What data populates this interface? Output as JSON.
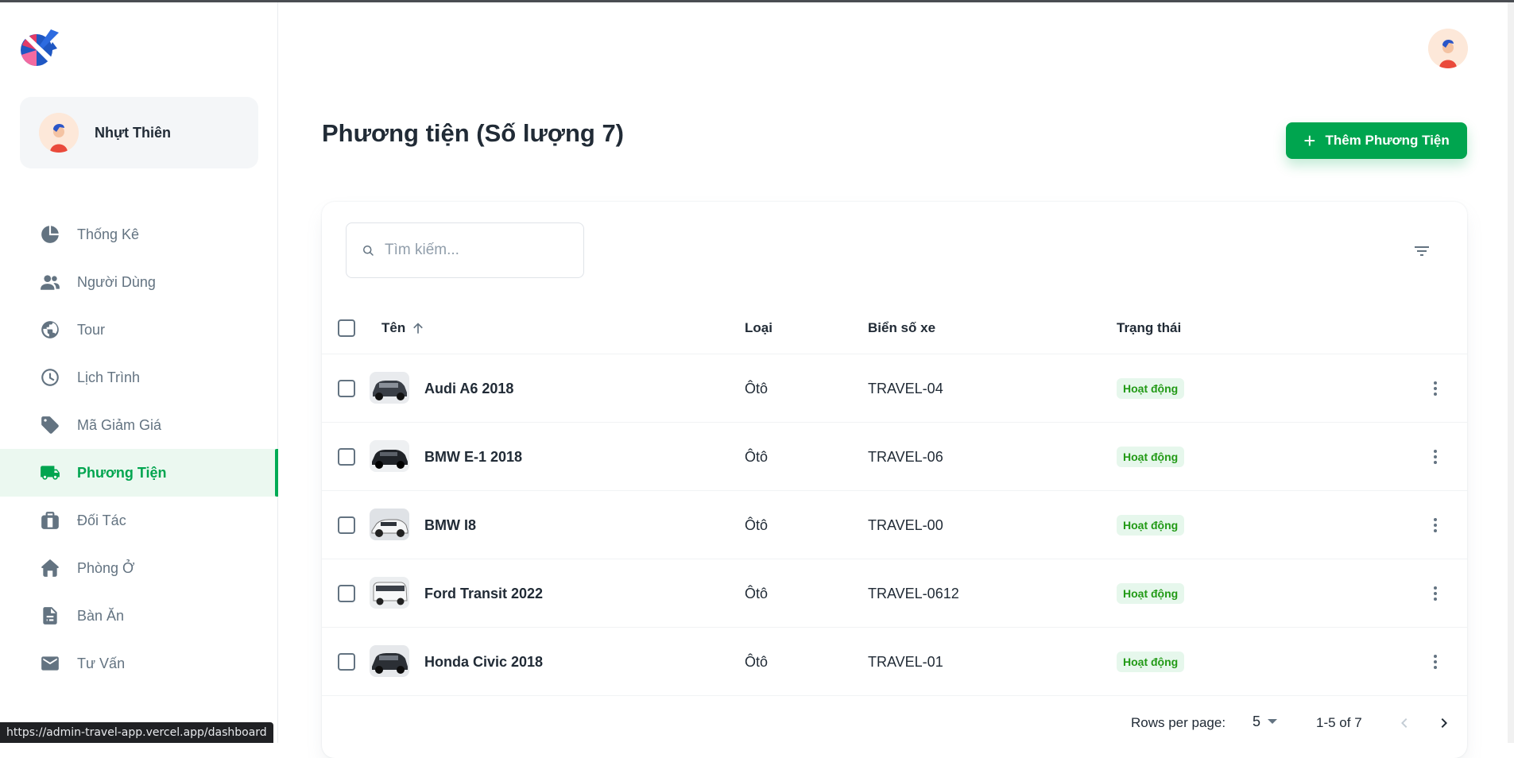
{
  "sidebar": {
    "account_name": "Nhựt Thiên",
    "items": [
      {
        "label": "Thống Kê",
        "icon": "pie-chart-icon"
      },
      {
        "label": "Người Dùng",
        "icon": "people-icon"
      },
      {
        "label": "Tour",
        "icon": "globe-icon"
      },
      {
        "label": "Lịch Trình",
        "icon": "clock-icon"
      },
      {
        "label": "Mã Giảm Giá",
        "icon": "tag-icon"
      },
      {
        "label": "Phương Tiện",
        "icon": "truck-icon",
        "active": true
      },
      {
        "label": "Đối Tác",
        "icon": "briefcase-icon"
      },
      {
        "label": "Phòng Ở",
        "icon": "home-icon"
      },
      {
        "label": "Bàn Ăn",
        "icon": "document-icon"
      },
      {
        "label": "Tư Vấn",
        "icon": "mail-icon"
      }
    ]
  },
  "main": {
    "title": "Phương tiện (Số lượng 7)",
    "add_button": "Thêm Phương Tiện",
    "search_placeholder": "Tìm kiếm...",
    "columns": [
      "Tên",
      "Loại",
      "Biển số xe",
      "Trạng thái"
    ],
    "rows": [
      {
        "name": "Audi A6 2018",
        "type": "Ôtô",
        "plate": "TRAVEL-04",
        "status": "Hoạt động"
      },
      {
        "name": "BMW E-1 2018",
        "type": "Ôtô",
        "plate": "TRAVEL-06",
        "status": "Hoạt động"
      },
      {
        "name": "BMW I8",
        "type": "Ôtô",
        "plate": "TRAVEL-00",
        "status": "Hoạt động"
      },
      {
        "name": "Ford Transit 2022",
        "type": "Ôtô",
        "plate": "TRAVEL-0612",
        "status": "Hoạt động"
      },
      {
        "name": "Honda Civic 2018",
        "type": "Ôtô",
        "plate": "TRAVEL-01",
        "status": "Hoạt động"
      }
    ],
    "pagination": {
      "rows_per_page_label": "Rows per page:",
      "rows_per_page": "5",
      "range": "1-5 of 7"
    }
  },
  "status_bar_url": "https://admin-travel-app.vercel.app/dashboard",
  "colors": {
    "accent": "#00a54f",
    "badge_bg": "#e6f7ec",
    "badge_text": "#229a16",
    "muted": "#637381"
  }
}
